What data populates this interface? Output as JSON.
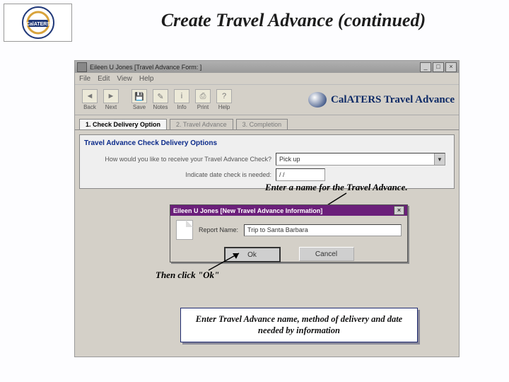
{
  "slide": {
    "title": "Create Travel Advance (continued)",
    "logo_label": "CalATERS"
  },
  "window": {
    "title": "Eileen U Jones [Travel Advance Form: ]",
    "menu": [
      "File",
      "Edit",
      "View",
      "Help"
    ],
    "toolbar": {
      "back": "Back",
      "next": "Next",
      "save": "Save",
      "notes": "Notes",
      "info": "Info",
      "print": "Print",
      "help": "Help"
    },
    "brand": "CalATERS Travel Advance",
    "tabs": [
      "1. Check Delivery Option",
      "2. Travel Advance",
      "3. Completion"
    ],
    "panel_title": "Travel Advance Check Delivery Options",
    "q1_label": "How would you like to receive your Travel Advance Check?",
    "q1_value": "Pick up",
    "q2_label": "Indicate date check is needed:",
    "q2_value": " / / "
  },
  "dialog": {
    "title": "Eileen U Jones [New Travel Advance Information]",
    "field_label": "Report Name:",
    "field_value": "Trip to Santa Barbara",
    "ok": "Ok",
    "cancel": "Cancel"
  },
  "annot": {
    "name": "Enter a name for the Travel Advance.",
    "ok": "Then click \"Ok\"",
    "footer": "Enter Travel Advance name, method of delivery and date needed by information"
  }
}
